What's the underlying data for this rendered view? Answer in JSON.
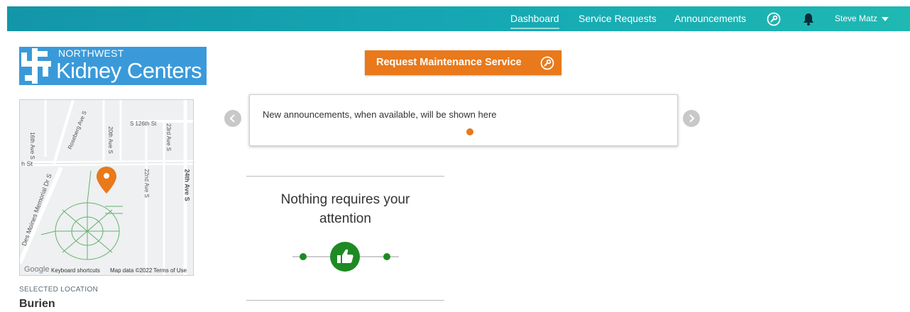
{
  "nav": {
    "items": [
      {
        "label": "Dashboard",
        "active": true
      },
      {
        "label": "Service Requests",
        "active": false
      },
      {
        "label": "Announcements",
        "active": false
      }
    ],
    "tools_icon": "wrench-icon",
    "notifications_icon": "bell-icon",
    "user_name": "Steve Matz"
  },
  "logo": {
    "line1": "NORTHWEST",
    "line2": "Kidney Centers"
  },
  "map": {
    "street_labels": [
      "S 126th St",
      "Roseberg Ave S",
      "20th Ave S",
      "23rd Ave S",
      "16th Ave S",
      "h St",
      "22nd Ave S",
      "24th Ave S",
      "Des Moines Memorial Dr S"
    ],
    "footer": {
      "google": "Google",
      "shortcuts": "Keyboard shortcuts",
      "mapdata": "Map data ©2022",
      "terms": "Terms of Use"
    }
  },
  "location": {
    "label": "SELECTED LOCATION",
    "name": "Burien"
  },
  "request_button": {
    "label": "Request Maintenance Service",
    "icon": "wrench-icon"
  },
  "announcements": {
    "text": "New announcements, when available, will be shown here",
    "prev_icon": "chevron-left-icon",
    "next_icon": "chevron-right-icon"
  },
  "status": {
    "message_line1": "Nothing requires your",
    "message_line2": "attention",
    "icon": "thumbs-up-icon"
  },
  "colors": {
    "accent": "#e9791a",
    "topbar": "#16a9b3",
    "logo_bg": "#3a9ad9",
    "success": "#1e8a24"
  }
}
